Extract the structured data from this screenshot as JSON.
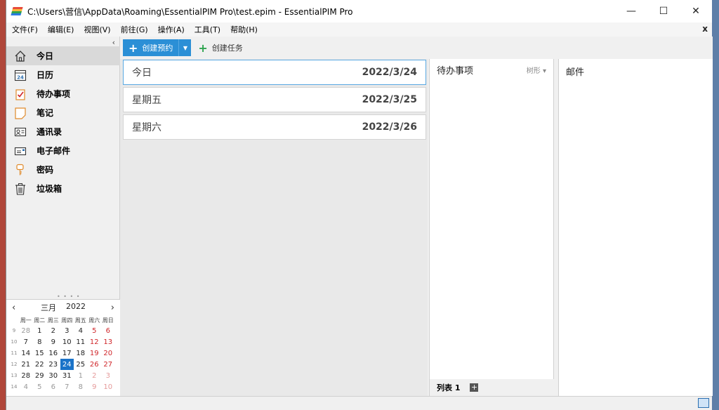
{
  "window": {
    "title": "C:\\Users\\营信\\AppData\\Roaming\\EssentialPIM Pro\\test.epim - EssentialPIM Pro",
    "minimize": "—",
    "maximize": "☐",
    "close": "✕"
  },
  "menu": {
    "items": [
      "文件(F)",
      "编辑(E)",
      "视图(V)",
      "前往(G)",
      "操作(A)",
      "工具(T)",
      "帮助(H)"
    ],
    "close": "x"
  },
  "sidebar": {
    "collapse": "‹",
    "items": [
      {
        "label": "今日",
        "icon": "home-icon"
      },
      {
        "label": "日历",
        "icon": "calendar-icon",
        "icon_text": "24"
      },
      {
        "label": "待办事项",
        "icon": "todo-check-icon"
      },
      {
        "label": "笔记",
        "icon": "note-icon"
      },
      {
        "label": "通讯录",
        "icon": "contacts-icon"
      },
      {
        "label": "电子邮件",
        "icon": "email-icon"
      },
      {
        "label": "密码",
        "icon": "key-icon"
      },
      {
        "label": "垃圾箱",
        "icon": "trash-icon"
      }
    ]
  },
  "minical": {
    "month": "三月",
    "year": "2022",
    "prev": "‹",
    "next": "›",
    "weekdays": [
      "周一",
      "周二",
      "周三",
      "周四",
      "周五",
      "周六",
      "周日"
    ],
    "weeks": [
      {
        "wk": "9",
        "days": [
          "28",
          "1",
          "2",
          "3",
          "4",
          "5",
          "6"
        ]
      },
      {
        "wk": "10",
        "days": [
          "7",
          "8",
          "9",
          "10",
          "11",
          "12",
          "13"
        ]
      },
      {
        "wk": "11",
        "days": [
          "14",
          "15",
          "16",
          "17",
          "18",
          "19",
          "20"
        ]
      },
      {
        "wk": "12",
        "days": [
          "21",
          "22",
          "23",
          "24",
          "25",
          "26",
          "27"
        ]
      },
      {
        "wk": "13",
        "days": [
          "28",
          "29",
          "30",
          "31",
          "1",
          "2",
          "3"
        ]
      },
      {
        "wk": "14",
        "days": [
          "4",
          "5",
          "6",
          "7",
          "8",
          "9",
          "10"
        ]
      }
    ],
    "today": "24"
  },
  "toolbar": {
    "new_appointment": "创建预约",
    "new_task": "创建任务"
  },
  "days": [
    {
      "name": "今日",
      "date": "2022/3/24"
    },
    {
      "name": "星期五",
      "date": "2022/3/25"
    },
    {
      "name": "星期六",
      "date": "2022/3/26"
    }
  ],
  "todo": {
    "title": "待办事项",
    "view": "树形 ▾",
    "tab": "列表 1",
    "add": "+"
  },
  "mail": {
    "title": "邮件"
  },
  "colors": {
    "accent": "#2b8fd6",
    "today_highlight": "#1a73c8",
    "weekend": "#d0262a"
  }
}
